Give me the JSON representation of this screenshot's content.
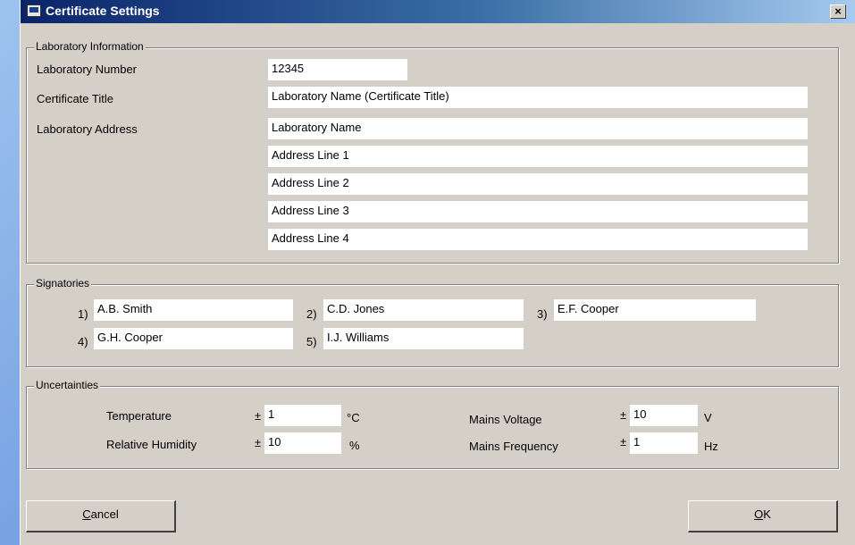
{
  "window": {
    "title": "Certificate Settings",
    "close_glyph": "×"
  },
  "lab": {
    "legend": "Laboratory Information",
    "number_label": "Laboratory Number",
    "number_value": "12345",
    "title_label": "Certificate Title",
    "title_value": "Laboratory Name (Certificate Title)",
    "address_label": "Laboratory Address",
    "address_lines": [
      "Laboratory Name",
      "Address Line 1",
      "Address Line 2",
      "Address Line 3",
      "Address Line 4"
    ]
  },
  "signatories": {
    "legend": "Signatories",
    "items": [
      {
        "num": "1)",
        "name": "A.B. Smith"
      },
      {
        "num": "2)",
        "name": "C.D. Jones"
      },
      {
        "num": "3)",
        "name": "E.F. Cooper"
      },
      {
        "num": "4)",
        "name": "G.H. Cooper"
      },
      {
        "num": "5)",
        "name": "I.J. Williams"
      }
    ]
  },
  "uncertainties": {
    "legend": "Uncertainties",
    "temperature": {
      "label": "Temperature",
      "pm": "±",
      "value": "1",
      "unit": "°C"
    },
    "humidity": {
      "label": "Relative Humidity",
      "pm": "±",
      "value": "10",
      "unit": "%"
    },
    "voltage": {
      "label": "Mains Voltage",
      "pm": "±",
      "value": "10",
      "unit": "V"
    },
    "frequency": {
      "label": "Mains Frequency",
      "pm": "±",
      "value": "1",
      "unit": "Hz"
    }
  },
  "buttons": {
    "cancel_accel": "C",
    "cancel_rest": "ancel",
    "ok_accel": "O",
    "ok_rest": "K"
  },
  "icons": {
    "window_icon": "computer-icon",
    "close": "close-icon"
  }
}
